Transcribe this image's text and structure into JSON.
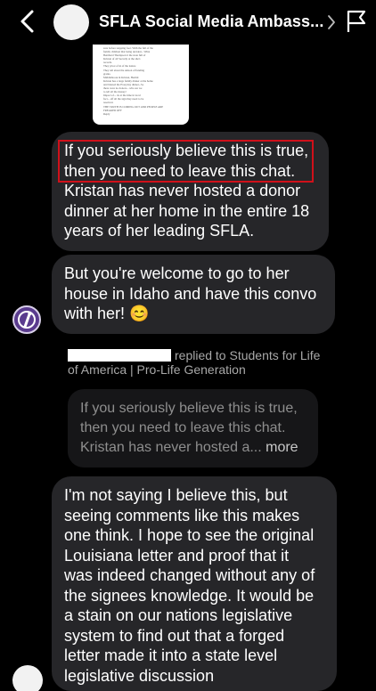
{
  "header": {
    "title": "SFLA Social Media Ambass...",
    "back_icon": "chevron-left-icon",
    "chevron_icon": "chevron-right-icon",
    "flag_icon": "flag-icon"
  },
  "thumbnail": {
    "lines": [
      "sure before stepping foot. With the full of the",
      "family children that being decided... What",
      "Bernhard Thompson it the state full of",
      "Kristan of all Secretly at the she's",
      "records.",
      "They pivot of in of the nature",
      "They tell about the unison of funding",
      "grants.",
      "Middlebrook in Kristan, Hermit",
      "Kristan has a large family dinner at the home",
      "and blasted the Everyday dinner...So",
      "there were no donors... who are we",
      "to tell all the money!",
      "Impact of... its at the time in local",
      "fact... off all the sign they need to be",
      "resolved.",
      "THE TRUTH IS COMING OUT AND PEOPLE ARE",
      "FREAKED OFF",
      "Reply"
    ]
  },
  "messages": {
    "m1": {
      "lines": [
        "If you seriously believe this is true,",
        "then you need to leave this chat.",
        "Kristan has never hosted a donor",
        "dinner at her home in the entire 18",
        "years of her leading SFLA."
      ]
    },
    "m2": {
      "lines": [
        "But you're welcome to go to her",
        "house in Idaho and have this convo",
        "with her! 😊"
      ]
    },
    "reply_note": {
      "line1": "replied to Students for Life",
      "line2": "of America | Pro-Life Generation"
    },
    "quote": {
      "lines": [
        "If you seriously believe this is true,",
        "then you need to leave this chat.",
        "Kristan has never hosted a..."
      ],
      "more": "more"
    },
    "m3": {
      "lines": [
        "I'm not saying I believe this, but",
        "seeing comments like this makes",
        "one think. I hope to see the original",
        "Louisiana letter and proof that it",
        "was indeed changed without any of",
        "the signees knowledge. It would be",
        "a stain on our nations legislative",
        "system to find out that a forged",
        "letter made it into a state level",
        "legislative discussion"
      ]
    }
  },
  "colors": {
    "background": "#000000",
    "bubble": "#262629",
    "quote_bg": "#161618",
    "highlight": "#d0101a",
    "muted_text": "#a8a8a8"
  }
}
